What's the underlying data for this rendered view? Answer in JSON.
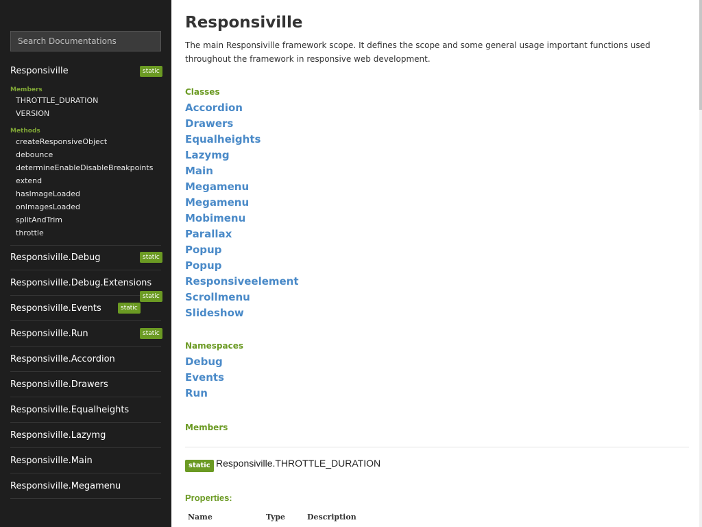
{
  "sidebar": {
    "search_placeholder": "Search Documentations",
    "badge_text": "static",
    "namespace_title": "Responsiville",
    "members_label": "Members",
    "members": [
      "THROTTLE_DURATION",
      "VERSION"
    ],
    "methods_label": "Methods",
    "methods": [
      "createResponsiveObject",
      "debounce",
      "determineEnableDisableBreakpoints",
      "extend",
      "hasImageLoaded",
      "onImagesLoaded",
      "splitAndTrim",
      "throttle"
    ],
    "nav": [
      "Responsiville.Debug",
      "Responsiville.Debug.Extensions",
      "Responsiville.Events",
      "Responsiville.Run",
      "Responsiville.Accordion",
      "Responsiville.Drawers",
      "Responsiville.Equalheights",
      "Responsiville.Lazymg",
      "Responsiville.Main",
      "Responsiville.Megamenu"
    ]
  },
  "main": {
    "title": "Responsiville",
    "description": "The main Responsiville framework scope. It defines the scope and some general usage important functions used throughout the framework in responsive web development.",
    "classes_label": "Classes",
    "classes": [
      "Accordion",
      "Drawers",
      "Equalheights",
      "Lazymg",
      "Main",
      "Megamenu",
      "Megamenu",
      "Mobimenu",
      "Parallax",
      "Popup",
      "Popup",
      "Responsiveelement",
      "Scrollmenu",
      "Slideshow"
    ],
    "namespaces_label": "Namespaces",
    "namespaces": [
      "Debug",
      "Events",
      "Run"
    ],
    "members_label": "Members",
    "member": {
      "badge": "static",
      "title": "Responsiville.THROTTLE_DURATION"
    },
    "properties_label": "Properties:",
    "table_headers": [
      "Name",
      "Type",
      "Description"
    ]
  },
  "colors": {
    "sidebar_bg": "#1e1e1e",
    "accent_green": "#6b9a23",
    "link_blue": "#4a8ac8"
  }
}
